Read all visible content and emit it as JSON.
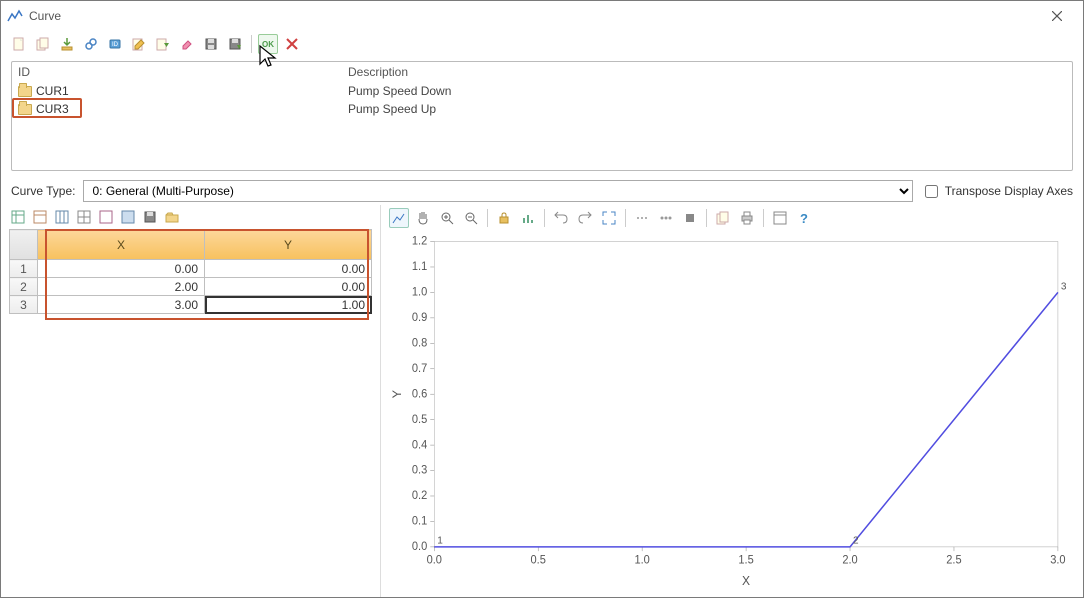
{
  "window": {
    "title": "Curve"
  },
  "list": {
    "headers": {
      "id": "ID",
      "desc": "Description"
    },
    "rows": [
      {
        "id": "CUR1",
        "desc": "Pump Speed Down"
      },
      {
        "id": "CUR3",
        "desc": "Pump Speed Up"
      }
    ],
    "selected_index": 1
  },
  "curve_type": {
    "label": "Curve Type:",
    "value": "0: General (Multi-Purpose)"
  },
  "transpose": {
    "label": "Transpose Display Axes",
    "checked": false
  },
  "table": {
    "columns": [
      "X",
      "Y"
    ],
    "rows": [
      {
        "n": "1",
        "x": "0.00",
        "y": "0.00"
      },
      {
        "n": "2",
        "x": "2.00",
        "y": "0.00"
      },
      {
        "n": "3",
        "x": "3.00",
        "y": "1.00"
      }
    ],
    "cursor": {
      "row": 2,
      "col": 1
    }
  },
  "chart_data": {
    "type": "line",
    "xlabel": "X",
    "ylabel": "Y",
    "xlim": [
      0.0,
      3.0
    ],
    "ylim": [
      0.0,
      1.2
    ],
    "xticks": [
      0.0,
      0.5,
      1.0,
      1.5,
      2.0,
      2.5,
      3.0
    ],
    "yticks": [
      0.0,
      0.1,
      0.2,
      0.3,
      0.4,
      0.5,
      0.6,
      0.7,
      0.8,
      0.9,
      1.0,
      1.1,
      1.2
    ],
    "series": [
      {
        "name": "",
        "x": [
          0.0,
          2.0,
          3.0
        ],
        "y": [
          0.0,
          0.0,
          1.0
        ]
      }
    ],
    "point_labels": [
      "1",
      "2",
      "3"
    ]
  },
  "icons": {
    "toolbar_main": [
      "new",
      "copy",
      "import",
      "link",
      "tag",
      "edit",
      "open",
      "erase",
      "save",
      "save-as",
      "ok",
      "cancel"
    ],
    "toolbar_table": [
      "col1",
      "col2",
      "col3",
      "col4",
      "col5",
      "col6",
      "save",
      "open"
    ],
    "toolbar_chart": [
      "line-chart",
      "pan",
      "zoom-in",
      "zoom-out",
      "lock",
      "bars",
      "undo",
      "redo",
      "fit",
      "hdots",
      "hdots2",
      "stop",
      "copy",
      "print",
      "layout",
      "help"
    ]
  }
}
